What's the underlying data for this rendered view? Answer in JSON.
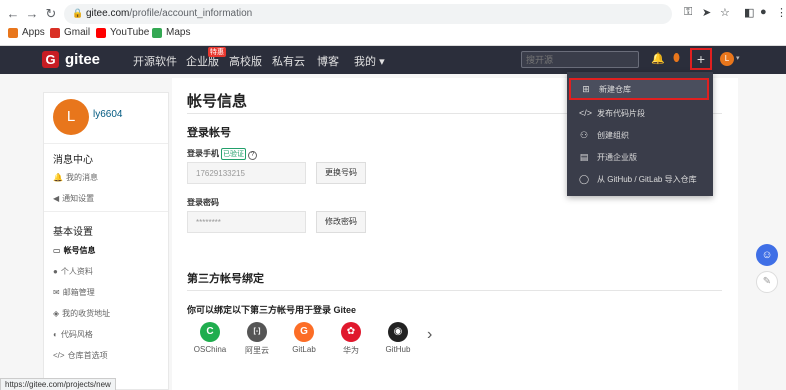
{
  "browser": {
    "url_host": "gitee.com",
    "url_path": "/profile/account_information",
    "bookmarks": [
      {
        "label": "Apps",
        "color": "#e8761c"
      },
      {
        "label": "Gmail",
        "color": "#d93025"
      },
      {
        "label": "YouTube",
        "color": "#ff0000"
      },
      {
        "label": "Maps",
        "color": "#34a853"
      }
    ],
    "status_url": "https://gitee.com/projects/new"
  },
  "header": {
    "logo": "gitee",
    "logo_letter": "G",
    "nav": [
      "开源软件",
      "企业版",
      "高校版",
      "私有云",
      "博客",
      "我的"
    ],
    "badge": "特惠",
    "search_placeholder": "搜开源",
    "plus": "+",
    "avatar_letter": "L"
  },
  "sidebar": {
    "avatar_letter": "L",
    "username": "ly6604",
    "sections": [
      {
        "title": "消息中心",
        "items": [
          {
            "icon": "bell-icon",
            "glyph": "🔔",
            "label": "我的消息"
          },
          {
            "icon": "speaker-icon",
            "glyph": "◀",
            "label": "通知设置"
          }
        ]
      },
      {
        "title": "基本设置",
        "items": [
          {
            "icon": "id-card-icon",
            "glyph": "▭",
            "label": "帐号信息"
          },
          {
            "icon": "person-icon",
            "glyph": "●",
            "label": "个人资料"
          },
          {
            "icon": "mail-icon",
            "glyph": "✉",
            "label": "邮箱管理"
          },
          {
            "icon": "location-icon",
            "glyph": "◈",
            "label": "我的收货地址"
          },
          {
            "icon": "palette-icon",
            "glyph": "◐",
            "label": "代码风格"
          },
          {
            "icon": "code-icon",
            "glyph": "</>",
            "label": "仓库首选项"
          }
        ]
      }
    ]
  },
  "main": {
    "title": "帐号信息",
    "login_section": "登录帐号",
    "phone_label": "登录手机",
    "verified": "已验证",
    "help_glyph": "?",
    "phone_value": "17629133215",
    "change_phone": "更换号码",
    "password_label": "登录密码",
    "password_value": "********",
    "change_password": "修改密码",
    "third_party_title": "第三方帐号绑定",
    "third_party_desc": "你可以绑定以下第三方帐号用于登录 Gitee",
    "socials": [
      {
        "label": "OSChina",
        "color": "#1fad4e",
        "glyph": "C"
      },
      {
        "label": "阿里云",
        "color": "#555",
        "glyph": "[-]"
      },
      {
        "label": "GitLab",
        "color": "#fc6d26",
        "glyph": "G"
      },
      {
        "label": "华为",
        "color": "#e0182d",
        "glyph": "✿"
      },
      {
        "label": "GitHub",
        "color": "#222",
        "glyph": "◉"
      }
    ],
    "more": "›"
  },
  "dropdown": {
    "items": [
      {
        "glyph": "⊞",
        "label": "新建仓库",
        "highlighted": true
      },
      {
        "glyph": "</>",
        "label": "发布代码片段"
      },
      {
        "glyph": "⚇",
        "label": "创建组织"
      },
      {
        "glyph": "▤",
        "label": "开通企业版"
      },
      {
        "glyph": "◯",
        "label": "从 GitHub / GitLab 导入仓库"
      }
    ]
  },
  "float": {
    "assistant": "☺",
    "feedback": "✎"
  }
}
